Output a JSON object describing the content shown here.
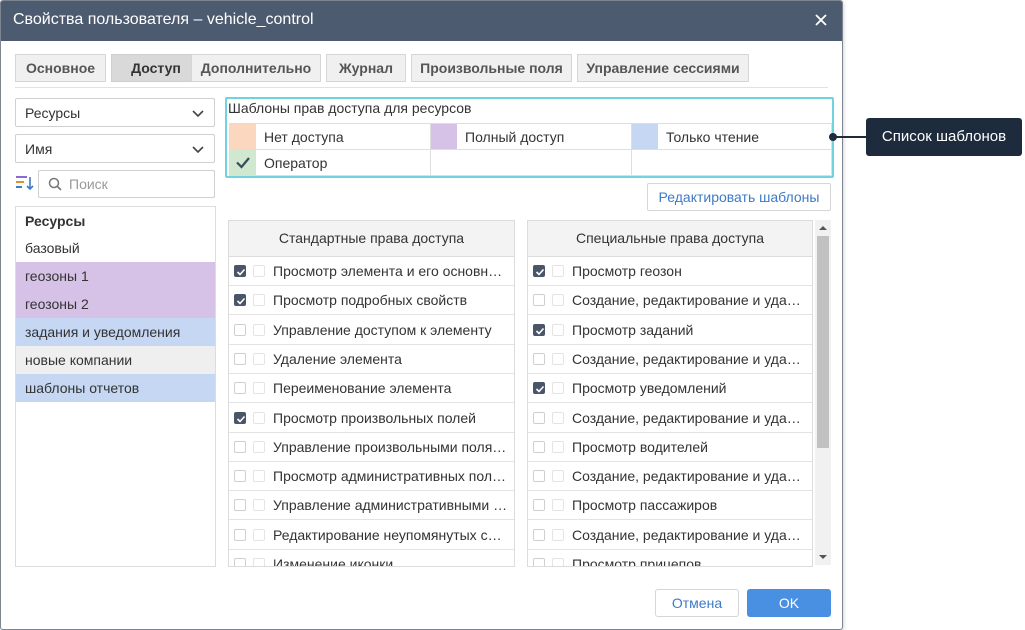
{
  "window": {
    "title": "Свойства пользователя – vehicle_control"
  },
  "tabs": [
    {
      "label": "Основное"
    },
    {
      "label": "Доступ"
    },
    {
      "label": "Дополнительно"
    },
    {
      "label": "Журнал"
    },
    {
      "label": "Произвольные поля"
    },
    {
      "label": "Управление сессиями"
    }
  ],
  "active_tab": "Доступ",
  "left": {
    "type_select": "Ресурсы",
    "sort_select": "Имя",
    "search_placeholder": "Поиск",
    "search_value": "",
    "list_header": "Ресурсы",
    "items": [
      {
        "label": "базовый",
        "color": "#ffffff"
      },
      {
        "label": "геозоны 1",
        "color": "#d6c2e6"
      },
      {
        "label": "геозоны 2",
        "color": "#d6c2e6"
      },
      {
        "label": "задания и уведомления",
        "color": "#c5d7f2"
      },
      {
        "label": "новые компании",
        "color": "#efefef"
      },
      {
        "label": "шаблоны отчетов",
        "color": "#c5d7f2"
      }
    ]
  },
  "templates": {
    "title": "Шаблоны прав доступа для ресурсов",
    "items": [
      {
        "label": "Нет доступа",
        "color": "#fcd7bf"
      },
      {
        "label": "Полный доступ",
        "color": "#d6c2e6"
      },
      {
        "label": "Только чтение",
        "color": "#c5d7f2"
      },
      {
        "label": "Оператор",
        "color": "#cfe8cf",
        "check": true
      }
    ],
    "edit_button": "Редактировать шаблоны"
  },
  "standard": {
    "header": "Стандартные права доступа",
    "rows": [
      {
        "label": "Просмотр элемента и его основн…",
        "checked": true
      },
      {
        "label": "Просмотр подробных свойств",
        "checked": true
      },
      {
        "label": "Управление доступом к элементу",
        "checked": false
      },
      {
        "label": "Удаление элемента",
        "checked": false
      },
      {
        "label": "Переименование элемента",
        "checked": false
      },
      {
        "label": "Просмотр произвольных полей",
        "checked": true
      },
      {
        "label": "Управление произвольными поля…",
        "checked": false
      },
      {
        "label": "Просмотр административных пол…",
        "checked": false
      },
      {
        "label": "Управление административными …",
        "checked": false
      },
      {
        "label": "Редактирование неупомянутых св…",
        "checked": false
      },
      {
        "label": "Изменение иконки",
        "checked": false
      }
    ]
  },
  "special": {
    "header": "Специальные права доступа",
    "rows": [
      {
        "label": "Просмотр геозон",
        "checked": true
      },
      {
        "label": "Создание, редактирование и удал…",
        "checked": false
      },
      {
        "label": "Просмотр заданий",
        "checked": true
      },
      {
        "label": "Создание, редактирование и удал…",
        "checked": false
      },
      {
        "label": "Просмотр уведомлений",
        "checked": true
      },
      {
        "label": "Создание, редактирование и удал…",
        "checked": false
      },
      {
        "label": "Просмотр водителей",
        "checked": false
      },
      {
        "label": "Создание, редактирование и удал…",
        "checked": false
      },
      {
        "label": "Просмотр пассажиров",
        "checked": false
      },
      {
        "label": "Создание, редактирование и удал…",
        "checked": false
      },
      {
        "label": "Просмотр прицепов",
        "checked": false
      }
    ]
  },
  "footer": {
    "cancel": "Отмена",
    "ok": "OK"
  },
  "callout": {
    "text": "Список шаблонов"
  },
  "colors": {
    "titlebar": "#4c5b70",
    "accent": "#4a90e2",
    "template_border": "#6fd3e2",
    "callout": "#1e2b3c"
  }
}
